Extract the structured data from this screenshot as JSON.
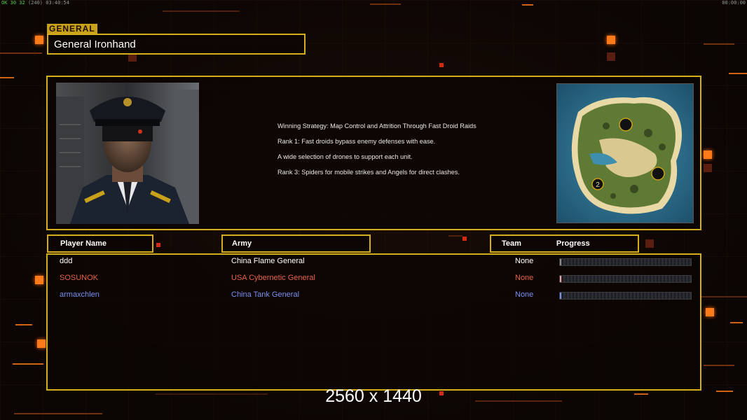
{
  "topbar": {
    "left_green": "OK 30 32",
    "left_gray": "(240)",
    "left_time": "03:40:54",
    "right_clock": "00:00:00"
  },
  "general": {
    "tag": "GENERAL",
    "name": "General Ironhand"
  },
  "strategy": [
    "Winning Strategy: Map Control and Attrition Through Fast Droid Raids",
    "Rank 1: Fast droids bypass enemy defenses with ease.",
    "A wide selection of drones to support each unit.",
    "Rank 3: Spiders for mobile strikes and Angels for direct clashes."
  ],
  "map": {
    "spawn_label": "2"
  },
  "headers": {
    "player": "Player Name",
    "army": "Army",
    "team": "Team",
    "progress": "Progress"
  },
  "players": [
    {
      "name": "ddd",
      "army": "China Flame General",
      "team": "None",
      "color": "#ffffff",
      "bar_color": "#8a8c90",
      "progress": 0
    },
    {
      "name": "SOSUNOK",
      "army": "USA Cybernetic General",
      "team": "None",
      "color": "#e8624a",
      "bar_color": "#f0a0a0",
      "progress": 0
    },
    {
      "name": "armaxchlen",
      "army": "China Tank General",
      "team": "None",
      "color": "#7a8ff0",
      "bar_color": "#7a8ff0",
      "progress": 0
    }
  ],
  "resolution": "2560 x 1440",
  "colors": {
    "frame": "#d6ae1c",
    "accent": "#ff7a18"
  }
}
